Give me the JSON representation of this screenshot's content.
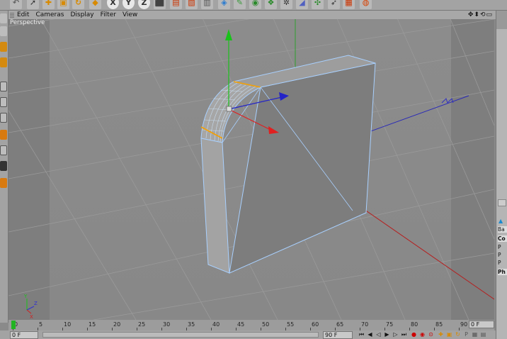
{
  "menu": {
    "items": [
      "Edit",
      "Cameras",
      "Display",
      "Filter",
      "View"
    ]
  },
  "viewport": {
    "label": "Perspective"
  },
  "axis_gizmo": {
    "y": "Y",
    "z": "Z",
    "x": "X"
  },
  "timeline": {
    "ticks": [
      "0",
      "5",
      "10",
      "15",
      "20",
      "25",
      "30",
      "35",
      "40",
      "45",
      "50",
      "55",
      "60",
      "65",
      "70",
      "75",
      "80",
      "85",
      "90"
    ],
    "current_frame": "0 F"
  },
  "bottom_bar": {
    "start_frame": "0 F",
    "end_frame": "90 F"
  },
  "right_panel": {
    "items": [
      "Ba",
      "Co",
      "P",
      "P",
      "P",
      "Ph"
    ]
  },
  "toolbar": {
    "icons": [
      "undo-icon",
      "select-icon",
      "move-icon",
      "scale-icon",
      "rotate-icon",
      "cube-icon",
      "x-axis-icon",
      "y-axis-icon",
      "z-axis-icon",
      "world-icon",
      "render-view-icon",
      "render-picture-icon",
      "render-settings-icon",
      "cube-primitive-icon",
      "spline-icon",
      "nurbs-icon",
      "array-icon",
      "deformer-icon",
      "scene-icon",
      "camera-icon",
      "light-icon"
    ]
  },
  "colors": {
    "y_axis": "#19c21a",
    "x_axis": "#e02020",
    "z_axis": "#2323c8",
    "selection": "#a8d0ff",
    "edge_highlight": "#f5a000"
  }
}
